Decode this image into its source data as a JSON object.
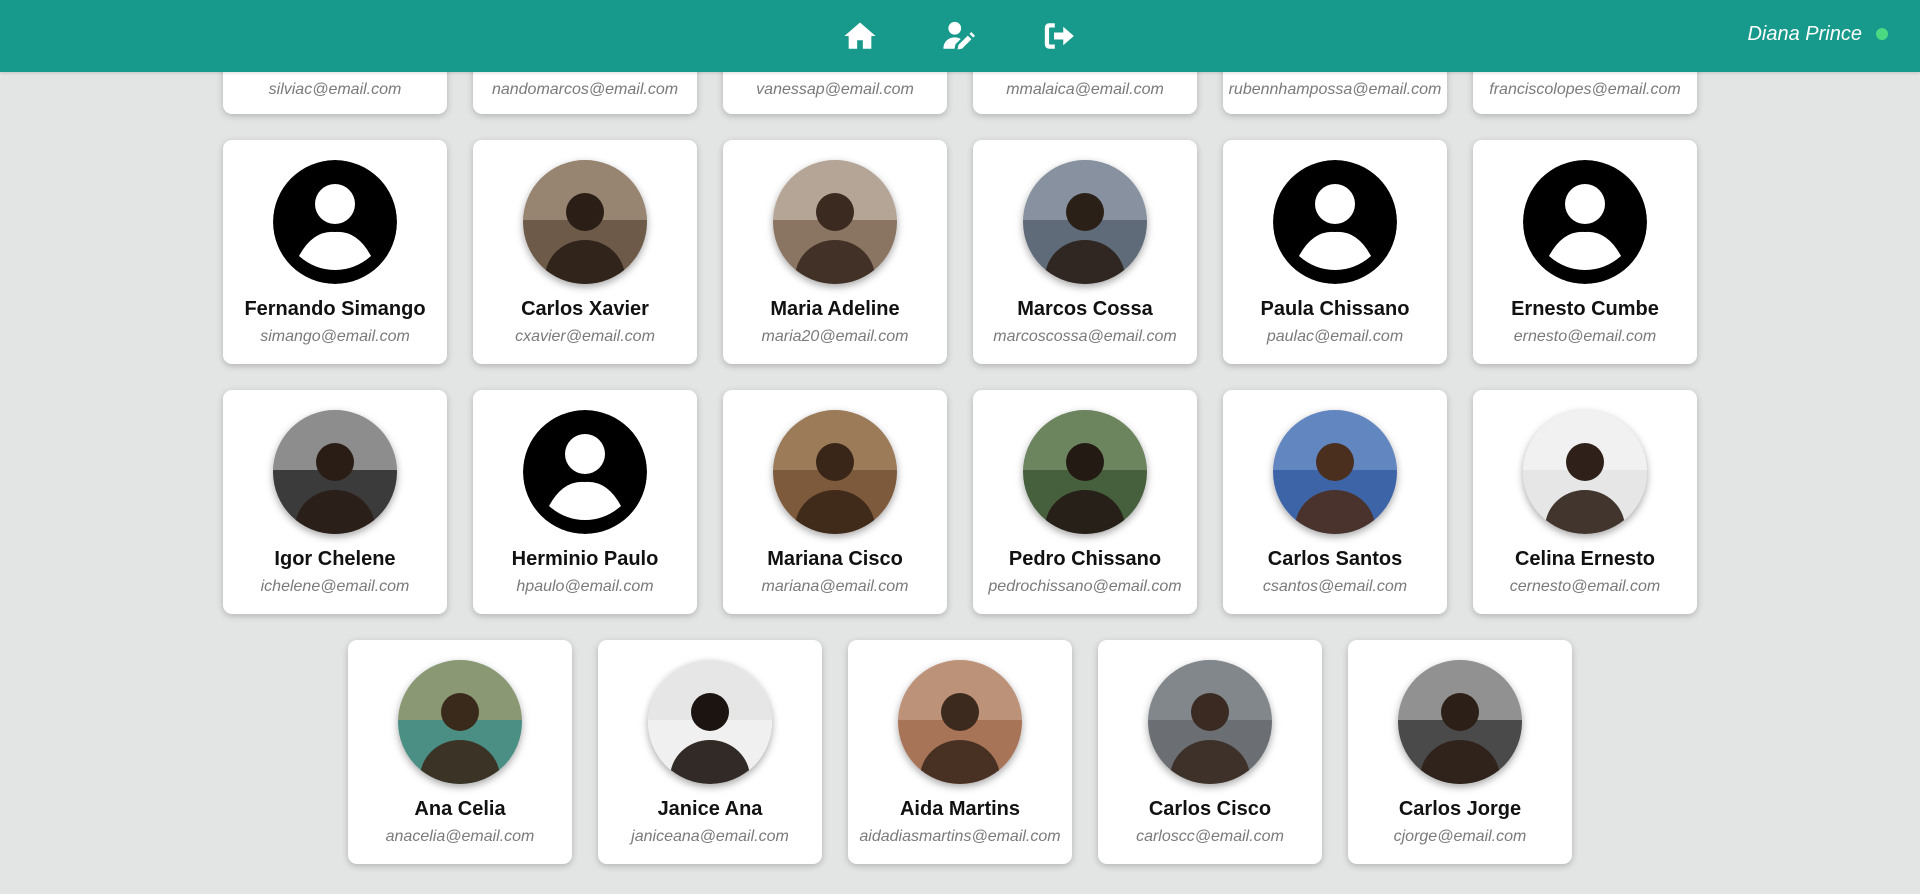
{
  "header": {
    "user_name": "Diana Prince",
    "nav": [
      {
        "icon": "home-icon"
      },
      {
        "icon": "edit-user-icon"
      },
      {
        "icon": "sign-out-icon"
      }
    ],
    "colors": {
      "bar": "#17998b",
      "status": "#4bd982"
    }
  },
  "partial_row": [
    {
      "email": "silviac@email.com"
    },
    {
      "email": "nandomarcos@email.com"
    },
    {
      "email": "vanessap@email.com"
    },
    {
      "email": "mmalaica@email.com"
    },
    {
      "email": "rubennhampossa@email.com"
    },
    {
      "email": "franciscolopes@email.com"
    }
  ],
  "users": [
    {
      "name": "Fernando Simango",
      "email": "simango@email.com",
      "avatar": "default-user-icon"
    },
    {
      "name": "Carlos Xavier",
      "email": "cxavier@email.com",
      "avatar": "photo"
    },
    {
      "name": "Maria Adeline",
      "email": "maria20@email.com",
      "avatar": "photo"
    },
    {
      "name": "Marcos Cossa",
      "email": "marcoscossa@email.com",
      "avatar": "photo"
    },
    {
      "name": "Paula Chissano",
      "email": "paulac@email.com",
      "avatar": "default-user-icon"
    },
    {
      "name": "Ernesto Cumbe",
      "email": "ernesto@email.com",
      "avatar": "default-user-icon"
    },
    {
      "name": "Igor Chelene",
      "email": "ichelene@email.com",
      "avatar": "photo"
    },
    {
      "name": "Herminio Paulo",
      "email": "hpaulo@email.com",
      "avatar": "default-user-icon"
    },
    {
      "name": "Mariana Cisco",
      "email": "mariana@email.com",
      "avatar": "photo"
    },
    {
      "name": "Pedro Chissano",
      "email": "pedrochissano@email.com",
      "avatar": "photo"
    },
    {
      "name": "Carlos Santos",
      "email": "csantos@email.com",
      "avatar": "photo"
    },
    {
      "name": "Celina Ernesto",
      "email": "cernesto@email.com",
      "avatar": "photo"
    },
    {
      "name": "Ana Celia",
      "email": "anacelia@email.com",
      "avatar": "photo"
    },
    {
      "name": "Janice Ana",
      "email": "janiceana@email.com",
      "avatar": "photo"
    },
    {
      "name": "Aida Martins",
      "email": "aidadiasmartins@email.com",
      "avatar": "photo"
    },
    {
      "name": "Carlos Cisco",
      "email": "carloscc@email.com",
      "avatar": "photo"
    },
    {
      "name": "Carlos Jorge",
      "email": "cjorge@email.com",
      "avatar": "photo"
    }
  ]
}
